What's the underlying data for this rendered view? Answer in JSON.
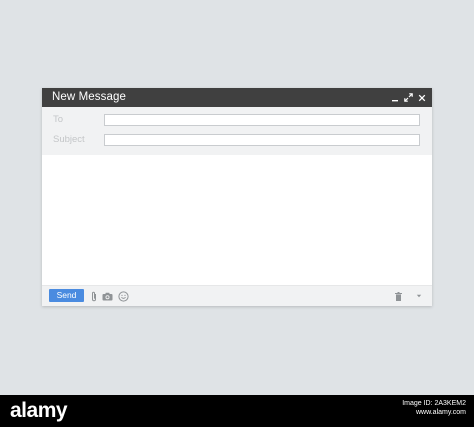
{
  "window": {
    "title": "New Message",
    "controls": {
      "minimize_icon": "minimize-icon",
      "expand_icon": "expand-icon",
      "close_icon": "close-icon"
    }
  },
  "fields": {
    "to": {
      "label": "To",
      "value": ""
    },
    "subject": {
      "label": "Subject",
      "value": ""
    }
  },
  "message_body": {
    "value": ""
  },
  "toolbar": {
    "send_label": "Send",
    "icons": [
      "paperclip-icon",
      "camera-icon",
      "emoji-icon",
      "trash-icon",
      "more-options-caret-icon"
    ]
  },
  "stock_strip": {
    "brand": "alamy",
    "image_id_line1": "Image ID: 2A3KEM2",
    "image_id_line2": "www.alamy.com"
  },
  "colors": {
    "background": "#dfe3e6",
    "titlebar": "#404040",
    "header": "#f1f2f3",
    "send_button": "#4a8be0",
    "icon_gray": "#8f9396"
  }
}
